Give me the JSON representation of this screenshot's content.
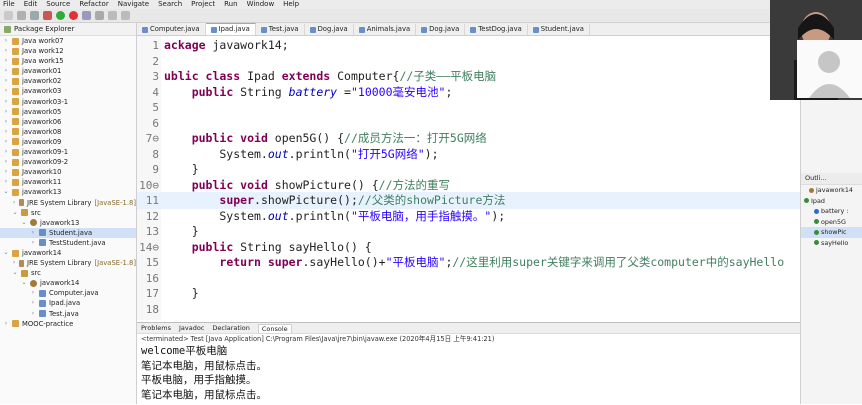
{
  "menubar": [
    "File",
    "Edit",
    "Source",
    "Refactor",
    "Navigate",
    "Search",
    "Project",
    "Run",
    "Window",
    "Help"
  ],
  "package_explorer": {
    "title": "Package Explorer",
    "items": [
      {
        "label": "Java work07",
        "depth": 0,
        "type": "proj",
        "arrow": ">"
      },
      {
        "label": "Java work12",
        "depth": 0,
        "type": "proj",
        "arrow": ">"
      },
      {
        "label": "Java work15",
        "depth": 0,
        "type": "proj",
        "arrow": ">"
      },
      {
        "label": "javawork01",
        "depth": 0,
        "type": "proj",
        "arrow": ">"
      },
      {
        "label": "javawork02",
        "depth": 0,
        "type": "proj",
        "arrow": ">"
      },
      {
        "label": "javawork03",
        "depth": 0,
        "type": "proj",
        "arrow": ">"
      },
      {
        "label": "javawork03-1",
        "depth": 0,
        "type": "proj",
        "arrow": ">"
      },
      {
        "label": "javawork05",
        "depth": 0,
        "type": "proj",
        "arrow": ">"
      },
      {
        "label": "javawork06",
        "depth": 0,
        "type": "proj",
        "arrow": ">"
      },
      {
        "label": "javawork08",
        "depth": 0,
        "type": "proj",
        "arrow": ">"
      },
      {
        "label": "javawork09",
        "depth": 0,
        "type": "proj",
        "arrow": ">"
      },
      {
        "label": "javawork09-1",
        "depth": 0,
        "type": "proj",
        "arrow": ">"
      },
      {
        "label": "javawork09-2",
        "depth": 0,
        "type": "proj",
        "arrow": ">"
      },
      {
        "label": "Javawork10",
        "depth": 0,
        "type": "proj",
        "arrow": ">"
      },
      {
        "label": "javawork11",
        "depth": 0,
        "type": "proj",
        "arrow": ">"
      },
      {
        "label": "javawork13",
        "depth": 0,
        "type": "proj",
        "arrow": "v"
      },
      {
        "label": "JRE System Library",
        "note": "[JavaSE-1.8]",
        "depth": 1,
        "type": "lib",
        "arrow": ">"
      },
      {
        "label": "src",
        "depth": 1,
        "type": "src",
        "arrow": "v"
      },
      {
        "label": "javawork13",
        "depth": 2,
        "type": "pkg",
        "arrow": "v"
      },
      {
        "label": "Student.java",
        "depth": 3,
        "type": "java",
        "arrow": ">",
        "selected": true
      },
      {
        "label": "TestStudent.java",
        "depth": 3,
        "type": "java",
        "arrow": ">"
      },
      {
        "label": "javawork14",
        "depth": 0,
        "type": "proj",
        "arrow": "v"
      },
      {
        "label": "JRE System Library",
        "note": "[JavaSE-1.8]",
        "depth": 1,
        "type": "lib",
        "arrow": ">"
      },
      {
        "label": "src",
        "depth": 1,
        "type": "src",
        "arrow": "v"
      },
      {
        "label": "javawork14",
        "depth": 2,
        "type": "pkg",
        "arrow": "v"
      },
      {
        "label": "Computer.java",
        "depth": 3,
        "type": "java",
        "arrow": ">"
      },
      {
        "label": "Ipad.java",
        "depth": 3,
        "type": "java",
        "arrow": ">"
      },
      {
        "label": "Test.java",
        "depth": 3,
        "type": "java",
        "arrow": ">"
      },
      {
        "label": "MOOC-practice",
        "depth": 0,
        "type": "proj",
        "arrow": ">"
      }
    ]
  },
  "editor_tabs": [
    {
      "label": "Computer.java",
      "active": false
    },
    {
      "label": "Ipad.java",
      "active": true
    },
    {
      "label": "Test.java",
      "active": false
    },
    {
      "label": "Dog.java",
      "active": false
    },
    {
      "label": "Animals.java",
      "active": false
    },
    {
      "label": "Dog.java",
      "active": false
    },
    {
      "label": "TestDog.java",
      "active": false
    },
    {
      "label": "Student.java",
      "active": false
    }
  ],
  "code": [
    {
      "n": "1",
      "cur": false,
      "segs": [
        {
          "t": "kw",
          "v": "ackage"
        },
        {
          "t": "p",
          "v": " javawork14;"
        }
      ]
    },
    {
      "n": "2",
      "cur": false,
      "segs": []
    },
    {
      "n": "3",
      "cur": false,
      "segs": [
        {
          "t": "kw",
          "v": "ublic class"
        },
        {
          "t": "p",
          "v": " Ipad "
        },
        {
          "t": "kw",
          "v": "extends"
        },
        {
          "t": "p",
          "v": " Computer{"
        },
        {
          "t": "cm",
          "v": "//子类——平板电脑"
        }
      ]
    },
    {
      "n": "4",
      "cur": false,
      "segs": [
        {
          "t": "p",
          "v": "    "
        },
        {
          "t": "kw",
          "v": "public"
        },
        {
          "t": "p",
          "v": " String "
        },
        {
          "t": "fld",
          "v": "battery"
        },
        {
          "t": "p",
          "v": " ="
        },
        {
          "t": "str",
          "v": "\"10000毫安电池\""
        },
        {
          "t": "p",
          "v": ";"
        }
      ]
    },
    {
      "n": "5",
      "cur": false,
      "segs": []
    },
    {
      "n": "6",
      "cur": false,
      "segs": []
    },
    {
      "n": "7⊖",
      "cur": false,
      "segs": [
        {
          "t": "p",
          "v": "    "
        },
        {
          "t": "kw",
          "v": "public void"
        },
        {
          "t": "p",
          "v": " open5G() {"
        },
        {
          "t": "cm",
          "v": "//成员方法一：打开5G网络"
        }
      ]
    },
    {
      "n": "8",
      "cur": false,
      "segs": [
        {
          "t": "p",
          "v": "        System."
        },
        {
          "t": "fld",
          "v": "out"
        },
        {
          "t": "p",
          "v": ".println("
        },
        {
          "t": "str",
          "v": "\"打开5G网络\""
        },
        {
          "t": "p",
          "v": ");"
        }
      ]
    },
    {
      "n": "9",
      "cur": false,
      "segs": [
        {
          "t": "p",
          "v": "    }"
        }
      ]
    },
    {
      "n": "10⊖",
      "cur": false,
      "segs": [
        {
          "t": "p",
          "v": "    "
        },
        {
          "t": "kw",
          "v": "public void"
        },
        {
          "t": "p",
          "v": " showPicture() {"
        },
        {
          "t": "cm",
          "v": "//方法的重写"
        }
      ]
    },
    {
      "n": "11",
      "cur": true,
      "segs": [
        {
          "t": "p",
          "v": "        "
        },
        {
          "t": "kw",
          "v": "super"
        },
        {
          "t": "p",
          "v": ".showPicture();"
        },
        {
          "t": "cm",
          "v": "//父类的showPicture方法"
        }
      ]
    },
    {
      "n": "12",
      "cur": false,
      "segs": [
        {
          "t": "p",
          "v": "        System."
        },
        {
          "t": "fld",
          "v": "out"
        },
        {
          "t": "p",
          "v": ".println("
        },
        {
          "t": "str",
          "v": "\"平板电脑，用手指触摸。\""
        },
        {
          "t": "p",
          "v": ");"
        }
      ]
    },
    {
      "n": "13",
      "cur": false,
      "segs": [
        {
          "t": "p",
          "v": "    }"
        }
      ]
    },
    {
      "n": "14⊖",
      "cur": false,
      "segs": [
        {
          "t": "p",
          "v": "    "
        },
        {
          "t": "kw",
          "v": "public"
        },
        {
          "t": "p",
          "v": " String sayHello() {"
        }
      ]
    },
    {
      "n": "15",
      "cur": false,
      "segs": [
        {
          "t": "p",
          "v": "        "
        },
        {
          "t": "kw",
          "v": "return super"
        },
        {
          "t": "p",
          "v": ".sayHello()+"
        },
        {
          "t": "str",
          "v": "\"平板电脑\""
        },
        {
          "t": "p",
          "v": ";"
        },
        {
          "t": "cm",
          "v": "//这里利用super关键字来调用了父类computer中的sayHello"
        }
      ]
    },
    {
      "n": "16",
      "cur": false,
      "segs": []
    },
    {
      "n": "17",
      "cur": false,
      "segs": [
        {
          "t": "p",
          "v": "    }"
        }
      ]
    },
    {
      "n": "18",
      "cur": false,
      "segs": []
    }
  ],
  "bottom_panel": {
    "tabs": [
      {
        "label": "Problems",
        "active": false
      },
      {
        "label": "Javadoc",
        "active": false
      },
      {
        "label": "Declaration",
        "active": false
      },
      {
        "label": "Console",
        "active": true
      }
    ],
    "terminated": "<terminated> Test [Java Application] C:\\Program Files\\Java\\jre7\\bin\\javaw.exe (2020年4月15日 上午9:41:21)",
    "output": [
      "welcome平板电脑",
      "笔记本电脑，用鼠标点击。",
      "平板电脑，用手指触摸。",
      "笔记本电脑，用鼠标点击。"
    ]
  },
  "outline": {
    "title": "Outli...",
    "items": [
      {
        "label": "javawork14",
        "dot": "#a07a3a",
        "indent": 1
      },
      {
        "label": "Ipad",
        "dot": "#3c8a3c",
        "indent": 0,
        "arrow": "v"
      },
      {
        "label": "battery :",
        "dot": "#2a6bd1",
        "indent": 2
      },
      {
        "label": "open5G",
        "dot": "#3c8a3c",
        "indent": 2
      },
      {
        "label": "showPic",
        "dot": "#3c8a3c",
        "indent": 2,
        "selected": true
      },
      {
        "label": "sayHello",
        "dot": "#3c8a3c",
        "indent": 2
      }
    ]
  },
  "colors": {
    "keyword": "#7f0055",
    "string": "#2a00ff",
    "comment": "#3f7f5f",
    "field": "#0000c0"
  }
}
